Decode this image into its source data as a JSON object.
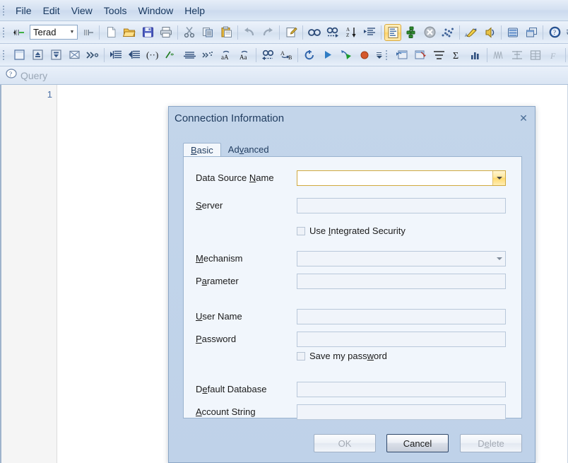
{
  "menu": {
    "items": [
      {
        "label": "File"
      },
      {
        "label": "Edit"
      },
      {
        "label": "View"
      },
      {
        "label": "Tools"
      },
      {
        "label": "Window"
      },
      {
        "label": "Help"
      }
    ]
  },
  "toolbar1": {
    "connection_combo_value": "Terad",
    "buttons": [
      {
        "name": "connect-icon",
        "title": "Connect"
      },
      {
        "name": "disconnect-icon",
        "title": "Disconnect"
      },
      {
        "name": "new-file-icon",
        "title": "New"
      },
      {
        "name": "open-folder-icon",
        "title": "Open"
      },
      {
        "name": "save-icon",
        "title": "Save"
      },
      {
        "name": "print-icon",
        "title": "Print"
      },
      {
        "name": "cut-icon",
        "title": "Cut"
      },
      {
        "name": "copy-icon",
        "title": "Copy"
      },
      {
        "name": "paste-icon",
        "title": "Paste"
      },
      {
        "name": "undo-icon",
        "title": "Undo"
      },
      {
        "name": "redo-icon",
        "title": "Redo"
      },
      {
        "name": "edit-note-icon",
        "title": "Edit"
      },
      {
        "name": "find-icon",
        "title": "Find"
      },
      {
        "name": "find-next-icon",
        "title": "Find Next"
      },
      {
        "name": "sort-az-icon",
        "title": "Sort"
      },
      {
        "name": "format-list-icon",
        "title": "Format"
      },
      {
        "name": "query-builder-icon",
        "title": "Query Builder"
      },
      {
        "name": "explain-icon",
        "title": "Explain"
      },
      {
        "name": "stop-icon",
        "title": "Stop"
      },
      {
        "name": "scatter-icon",
        "title": "Visual Explain"
      },
      {
        "name": "highlighter-icon",
        "title": "Highlight"
      },
      {
        "name": "sound-icon",
        "title": "Notify"
      },
      {
        "name": "database-icon",
        "title": "Database"
      },
      {
        "name": "windows-icon",
        "title": "Windows"
      },
      {
        "name": "help-icon",
        "title": "Help"
      }
    ]
  },
  "toolbar2": {
    "buttons": [
      {
        "name": "blank-icon",
        "title": "Blank"
      },
      {
        "name": "expand-icon",
        "title": "Expand"
      },
      {
        "name": "collapse-icon",
        "title": "Collapse"
      },
      {
        "name": "close-box-icon",
        "title": "Close"
      },
      {
        "name": "skip-icon",
        "title": "Skip"
      },
      {
        "name": "indent-icon",
        "title": "Indent"
      },
      {
        "name": "outdent-icon",
        "title": "Outdent"
      },
      {
        "name": "comment-icon",
        "title": "Comment"
      },
      {
        "name": "uncomment-icon",
        "title": "Uncomment"
      },
      {
        "name": "strike-icon",
        "title": "Strike"
      },
      {
        "name": "advance-icon",
        "title": "Advance"
      },
      {
        "name": "lowercase-icon",
        "title": "Lowercase"
      },
      {
        "name": "uppercase-icon",
        "title": "Uppercase"
      },
      {
        "name": "find-back-icon",
        "title": "Find Previous"
      },
      {
        "name": "replace-icon",
        "title": "Replace"
      },
      {
        "name": "refresh-icon",
        "title": "Refresh"
      },
      {
        "name": "execute-icon",
        "title": "Execute"
      },
      {
        "name": "execute-parallel-icon",
        "title": "Execute Parallel"
      },
      {
        "name": "record-icon",
        "title": "Record"
      },
      {
        "name": "import-icon",
        "title": "Import"
      },
      {
        "name": "export-icon",
        "title": "Export"
      },
      {
        "name": "align-icon",
        "title": "Align"
      },
      {
        "name": "sum-icon",
        "title": "Sum"
      },
      {
        "name": "chart-icon",
        "title": "Chart"
      },
      {
        "name": "wave-icon",
        "title": "Wave"
      },
      {
        "name": "center-icon",
        "title": "Center"
      },
      {
        "name": "table-grid-icon",
        "title": "Grid"
      },
      {
        "name": "function-icon",
        "title": "Function"
      },
      {
        "name": "answerset-icon",
        "title": "Answerset",
        "active": true
      },
      {
        "name": "answerset-grid-icon",
        "title": "Answerset Grid",
        "active": true
      },
      {
        "name": "answerset-table-icon",
        "title": "Answerset Table",
        "active": true
      }
    ]
  },
  "document_tab": {
    "label": "Query",
    "icon": "query-help-icon"
  },
  "editor": {
    "line_number": "1",
    "content": ""
  },
  "dialog": {
    "title": "Connection Information",
    "close_label": "✕",
    "tabs": [
      {
        "label_before": "",
        "mnemonic": "B",
        "label_after": "asic",
        "selected": true,
        "name": "tab-basic"
      },
      {
        "label_before": "Ad",
        "mnemonic": "v",
        "label_after": "anced",
        "selected": false,
        "name": "tab-advanced"
      }
    ],
    "fields": [
      {
        "name": "data-source-name",
        "label_before": "Data Source ",
        "mnemonic": "N",
        "label_after": "ame",
        "type": "combobox",
        "value": "",
        "state": "focused"
      },
      {
        "name": "server",
        "label_before": "",
        "mnemonic": "S",
        "label_after": "erver",
        "type": "text",
        "value": "",
        "state": "disabled"
      },
      {
        "name": "mechanism",
        "label_before": "",
        "mnemonic": "M",
        "label_after": "echanism",
        "type": "combobox",
        "value": "",
        "state": "disabled"
      },
      {
        "name": "parameter",
        "label_before": "P",
        "mnemonic": "a",
        "label_after": "rameter",
        "type": "text",
        "value": "",
        "state": "disabled"
      },
      {
        "name": "user-name",
        "label_before": "",
        "mnemonic": "U",
        "label_after": "ser Name",
        "type": "text",
        "value": "",
        "state": "disabled"
      },
      {
        "name": "password",
        "label_before": "",
        "mnemonic": "P",
        "label_after": "assword",
        "type": "password",
        "value": "",
        "state": "disabled"
      },
      {
        "name": "default-database",
        "label_before": "D",
        "mnemonic": "e",
        "label_after": "fault Database",
        "type": "text",
        "value": "",
        "state": "disabled"
      },
      {
        "name": "account-string",
        "label_before": "",
        "mnemonic": "A",
        "label_after": "ccount String",
        "type": "text",
        "value": "",
        "state": "disabled"
      }
    ],
    "checkboxes": [
      {
        "name": "use-integrated-security",
        "label_before": "Use ",
        "mnemonic": "I",
        "label_after": "ntegrated Security",
        "checked": false
      },
      {
        "name": "save-my-password",
        "label_before": "Save my pass",
        "mnemonic": "w",
        "label_after": "ord",
        "checked": false
      }
    ],
    "buttons": [
      {
        "name": "ok-button",
        "label": "OK",
        "state": "disabled"
      },
      {
        "name": "cancel-button",
        "label": "Cancel",
        "state": "default"
      },
      {
        "name": "delete-button",
        "label_before": "D",
        "mnemonic": "e",
        "label_after": "lete",
        "label": "Delete",
        "state": "disabled"
      }
    ]
  },
  "colors": {
    "dialog_bg": "#c1d3ea",
    "panel_bg": "#f1f6fc",
    "accent_gold": "#ffd96d",
    "menu_text": "#17375e",
    "line_number": "#4a6fa5"
  }
}
